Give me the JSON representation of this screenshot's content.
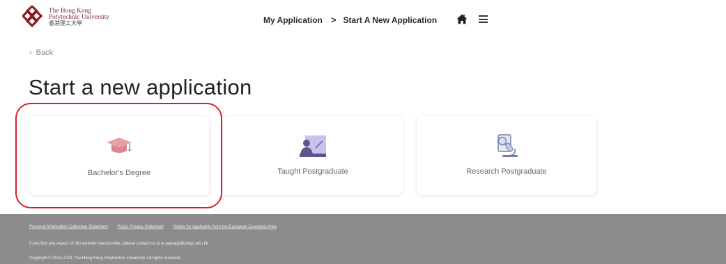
{
  "header": {
    "logo": {
      "line1": "The Hong Kong",
      "line2": "Polytechnic University",
      "line3": "香港理工大學",
      "brand_color": "#6b2028"
    },
    "breadcrumb": {
      "item1": "My Application",
      "separator": ">",
      "item2": "Start A New Application"
    },
    "icons": [
      "home-icon",
      "menu-icon"
    ]
  },
  "back": {
    "chevron": "‹",
    "label": "Back"
  },
  "page_title": "Start a new application",
  "cards": [
    {
      "label": "Bachelor's Degree",
      "icon": "graduation-cap-icon"
    },
    {
      "label": "Taught Postgraduate",
      "icon": "teacher-board-icon"
    },
    {
      "label": "Research Postgraduate",
      "icon": "microscope-icon"
    }
  ],
  "highlight_color": "#d61f26",
  "footer": {
    "links": [
      "Personal Information Collection Statement",
      "PolyU Privacy Statement",
      "Notice for Applicants from the European Economic Area"
    ],
    "accessibility": "If you find any aspect of this website inaccessible, please contact us at ar.webapp@polyu.edu.hk",
    "copyright": "Copyright © 2015-2021 The Hong Kong Polytechnic University. All rights reserved.",
    "background": "#8c8c8c"
  }
}
